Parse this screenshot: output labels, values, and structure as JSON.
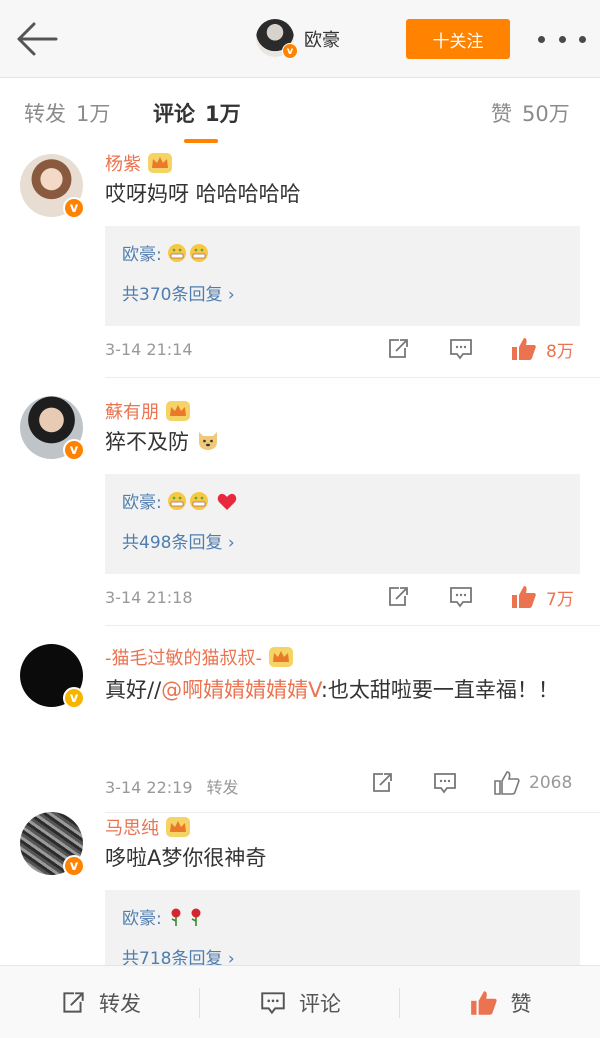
{
  "header": {
    "name": "欧豪",
    "follow_label": "十关注"
  },
  "tabs": {
    "repost": {
      "label": "转发",
      "count": "1万"
    },
    "comment": {
      "label": "评论",
      "count": "1万"
    },
    "like": {
      "label": "赞",
      "count": "50万"
    }
  },
  "comments": [
    {
      "name": "杨紫",
      "text": "哎呀妈呀 哈哈哈哈哈",
      "reply_author": "欧豪:",
      "reply_more": "共370条回复 ›",
      "time": "3-14 21:14",
      "likes": "8万"
    },
    {
      "name": "蘇有朋",
      "text": "猝不及防",
      "reply_author": "欧豪:",
      "reply_more": "共498条回复 ›",
      "time": "3-14 21:18",
      "likes": "7万"
    },
    {
      "name": "-猫毛过敏的猫叔叔-",
      "text_prefix": "真好//",
      "mention": "@啊婧婧婧婧婧V",
      "text_suffix": ":也太甜啦要一直幸福！！",
      "time": "3-14 22:19",
      "repost_label": "转发",
      "likes": "2068"
    },
    {
      "name": "马思纯",
      "text": "哆啦A梦你很神奇",
      "reply_author": "欧豪:",
      "reply_more": "共718条回复 ›"
    }
  ],
  "bottom": {
    "repost_label": "转发",
    "comment_label": "评论",
    "like_label": "赞"
  },
  "colors": {
    "accent": "#ff8200",
    "username": "#eb7350",
    "link": "#507daf"
  },
  "icons": [
    "back-arrow-icon",
    "more-icon",
    "verified-badge-icon",
    "crown-icon",
    "share-icon",
    "comment-icon",
    "like-icon",
    "grimace-emoji-icon",
    "heart-emoji-icon",
    "dog-emoji-icon",
    "rose-emoji-icon"
  ]
}
